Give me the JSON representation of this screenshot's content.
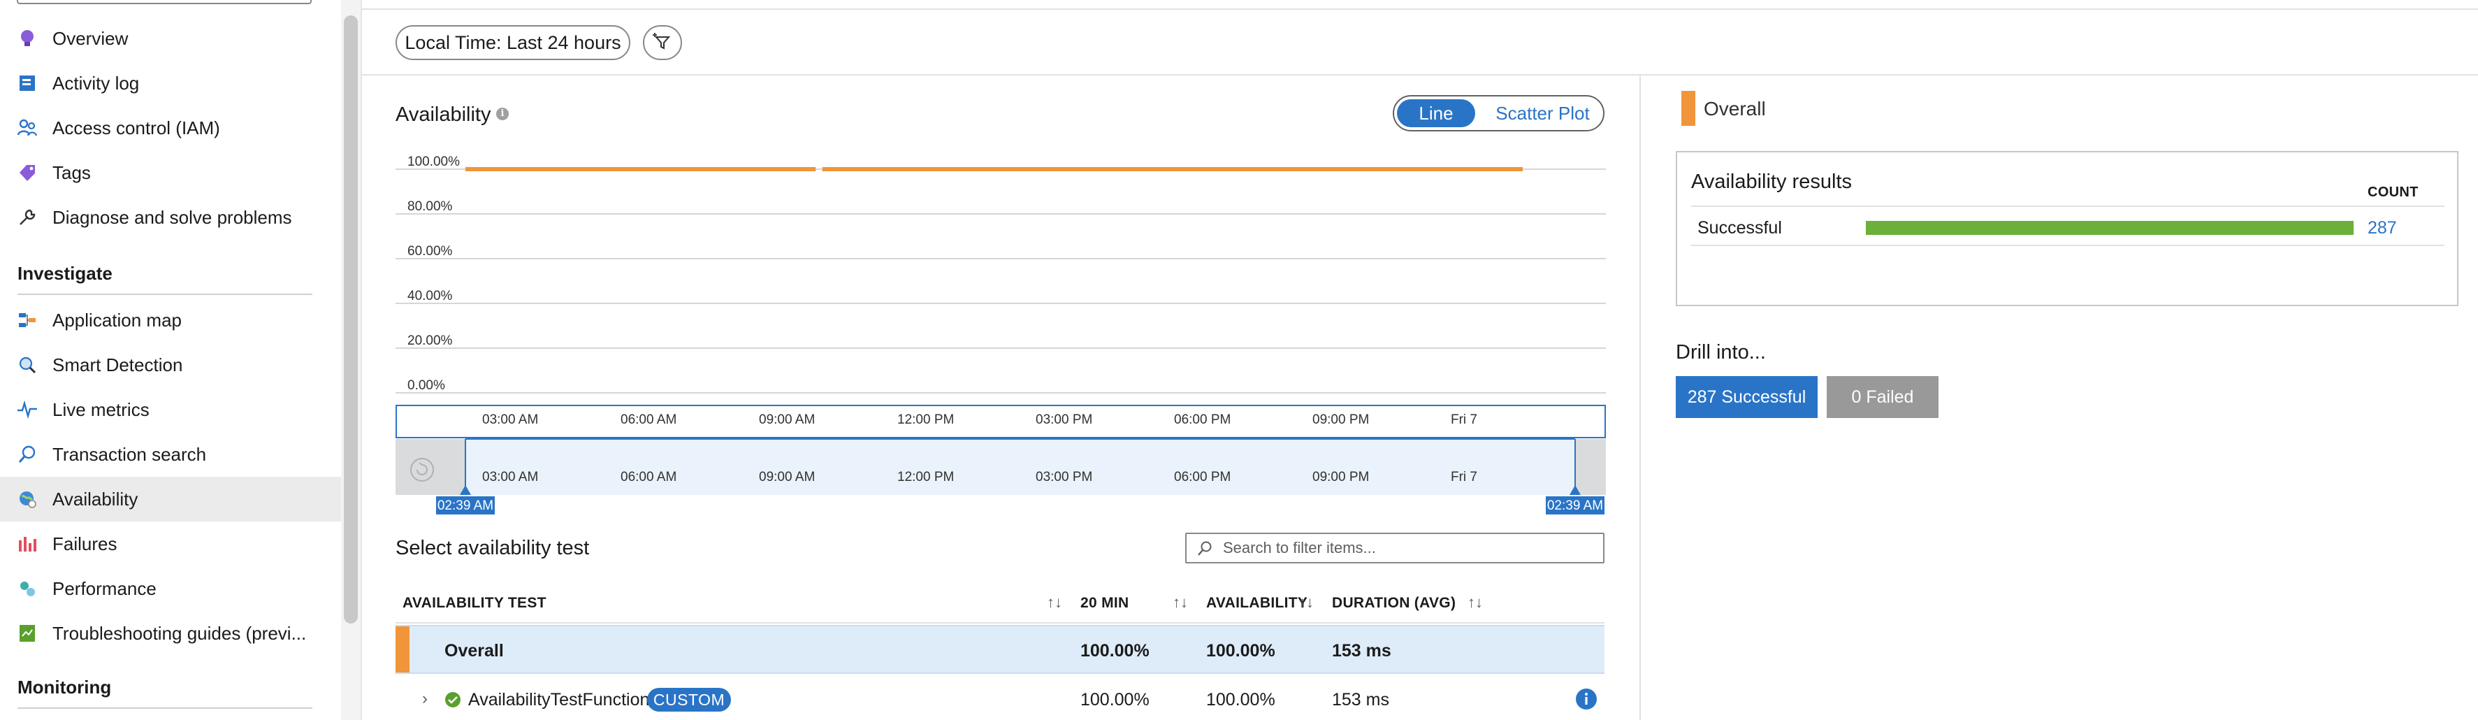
{
  "sidebar": {
    "items": [
      {
        "label": "Overview",
        "icon": "overview-bulb-icon"
      },
      {
        "label": "Activity log",
        "icon": "activity-log-icon"
      },
      {
        "label": "Access control (IAM)",
        "icon": "people-icon"
      },
      {
        "label": "Tags",
        "icon": "tag-icon"
      },
      {
        "label": "Diagnose and solve problems",
        "icon": "wrench-icon"
      }
    ],
    "investigate_header": "Investigate",
    "investigate_items": [
      {
        "label": "Application map",
        "icon": "app-map-icon"
      },
      {
        "label": "Smart Detection",
        "icon": "smart-detection-icon"
      },
      {
        "label": "Live metrics",
        "icon": "live-metrics-icon"
      },
      {
        "label": "Transaction search",
        "icon": "search-icon"
      },
      {
        "label": "Availability",
        "icon": "globe-icon",
        "active": true
      },
      {
        "label": "Failures",
        "icon": "failures-chart-icon"
      },
      {
        "label": "Performance",
        "icon": "performance-icon"
      },
      {
        "label": "Troubleshooting guides (previ...",
        "icon": "guides-icon"
      }
    ],
    "monitoring_header": "Monitoring"
  },
  "toolbar": {
    "time_range": "Local Time: Last 24 hours",
    "filter_icon": "add-filter-icon"
  },
  "availability_panel": {
    "title": "Availability",
    "view_toggle": {
      "line": "Line",
      "scatter": "Scatter Plot",
      "selected": "Line"
    }
  },
  "chart_data": {
    "type": "line",
    "title": "Availability",
    "y_ticks": [
      "100.00%",
      "80.00%",
      "60.00%",
      "40.00%",
      "20.00%",
      "0.00%"
    ],
    "ylim": [
      0,
      100
    ],
    "x_ticks": [
      "03:00 AM",
      "06:00 AM",
      "09:00 AM",
      "12:00 PM",
      "03:00 PM",
      "06:00 PM",
      "09:00 PM",
      "Fri 7"
    ],
    "series": [
      {
        "name": "Overall",
        "color": "#f0953a",
        "segments": [
          [
            0.0,
            0.316
          ],
          [
            0.322,
            0.954
          ]
        ],
        "value": 100
      }
    ],
    "brush": {
      "x_ticks": [
        "03:00 AM",
        "06:00 AM",
        "09:00 AM",
        "12:00 PM",
        "03:00 PM",
        "06:00 PM",
        "09:00 PM",
        "Fri 7"
      ],
      "start_label": "02:39 AM",
      "end_label": "02:39 AM"
    }
  },
  "table": {
    "title": "Select availability test",
    "search_placeholder": "Search to filter items...",
    "columns": [
      "AVAILABILITY TEST",
      "20 MIN",
      "AVAILABILITY",
      "DURATION (AVG)"
    ],
    "overall": {
      "name": "Overall",
      "min20": "100.00%",
      "availability": "100.00%",
      "duration": "153 ms"
    },
    "rows": [
      {
        "name": "AvailabilityTestFunction",
        "badge": "CUSTOM",
        "min20": "100.00%",
        "availability": "100.00%",
        "duration": "153 ms"
      }
    ]
  },
  "right_panel": {
    "legend": "Overall",
    "results_title": "Availability results",
    "count_header": "COUNT",
    "results": [
      {
        "label": "Successful",
        "count": "287",
        "fraction": 1.0,
        "color": "#6bb03a"
      }
    ],
    "drill_title": "Drill into...",
    "successful_button": "287 Successful",
    "failed_button": "0 Failed"
  },
  "colors": {
    "accent": "#2a74c7",
    "series": "#f0953a",
    "success": "#6bb03a",
    "failed": "#999999"
  }
}
